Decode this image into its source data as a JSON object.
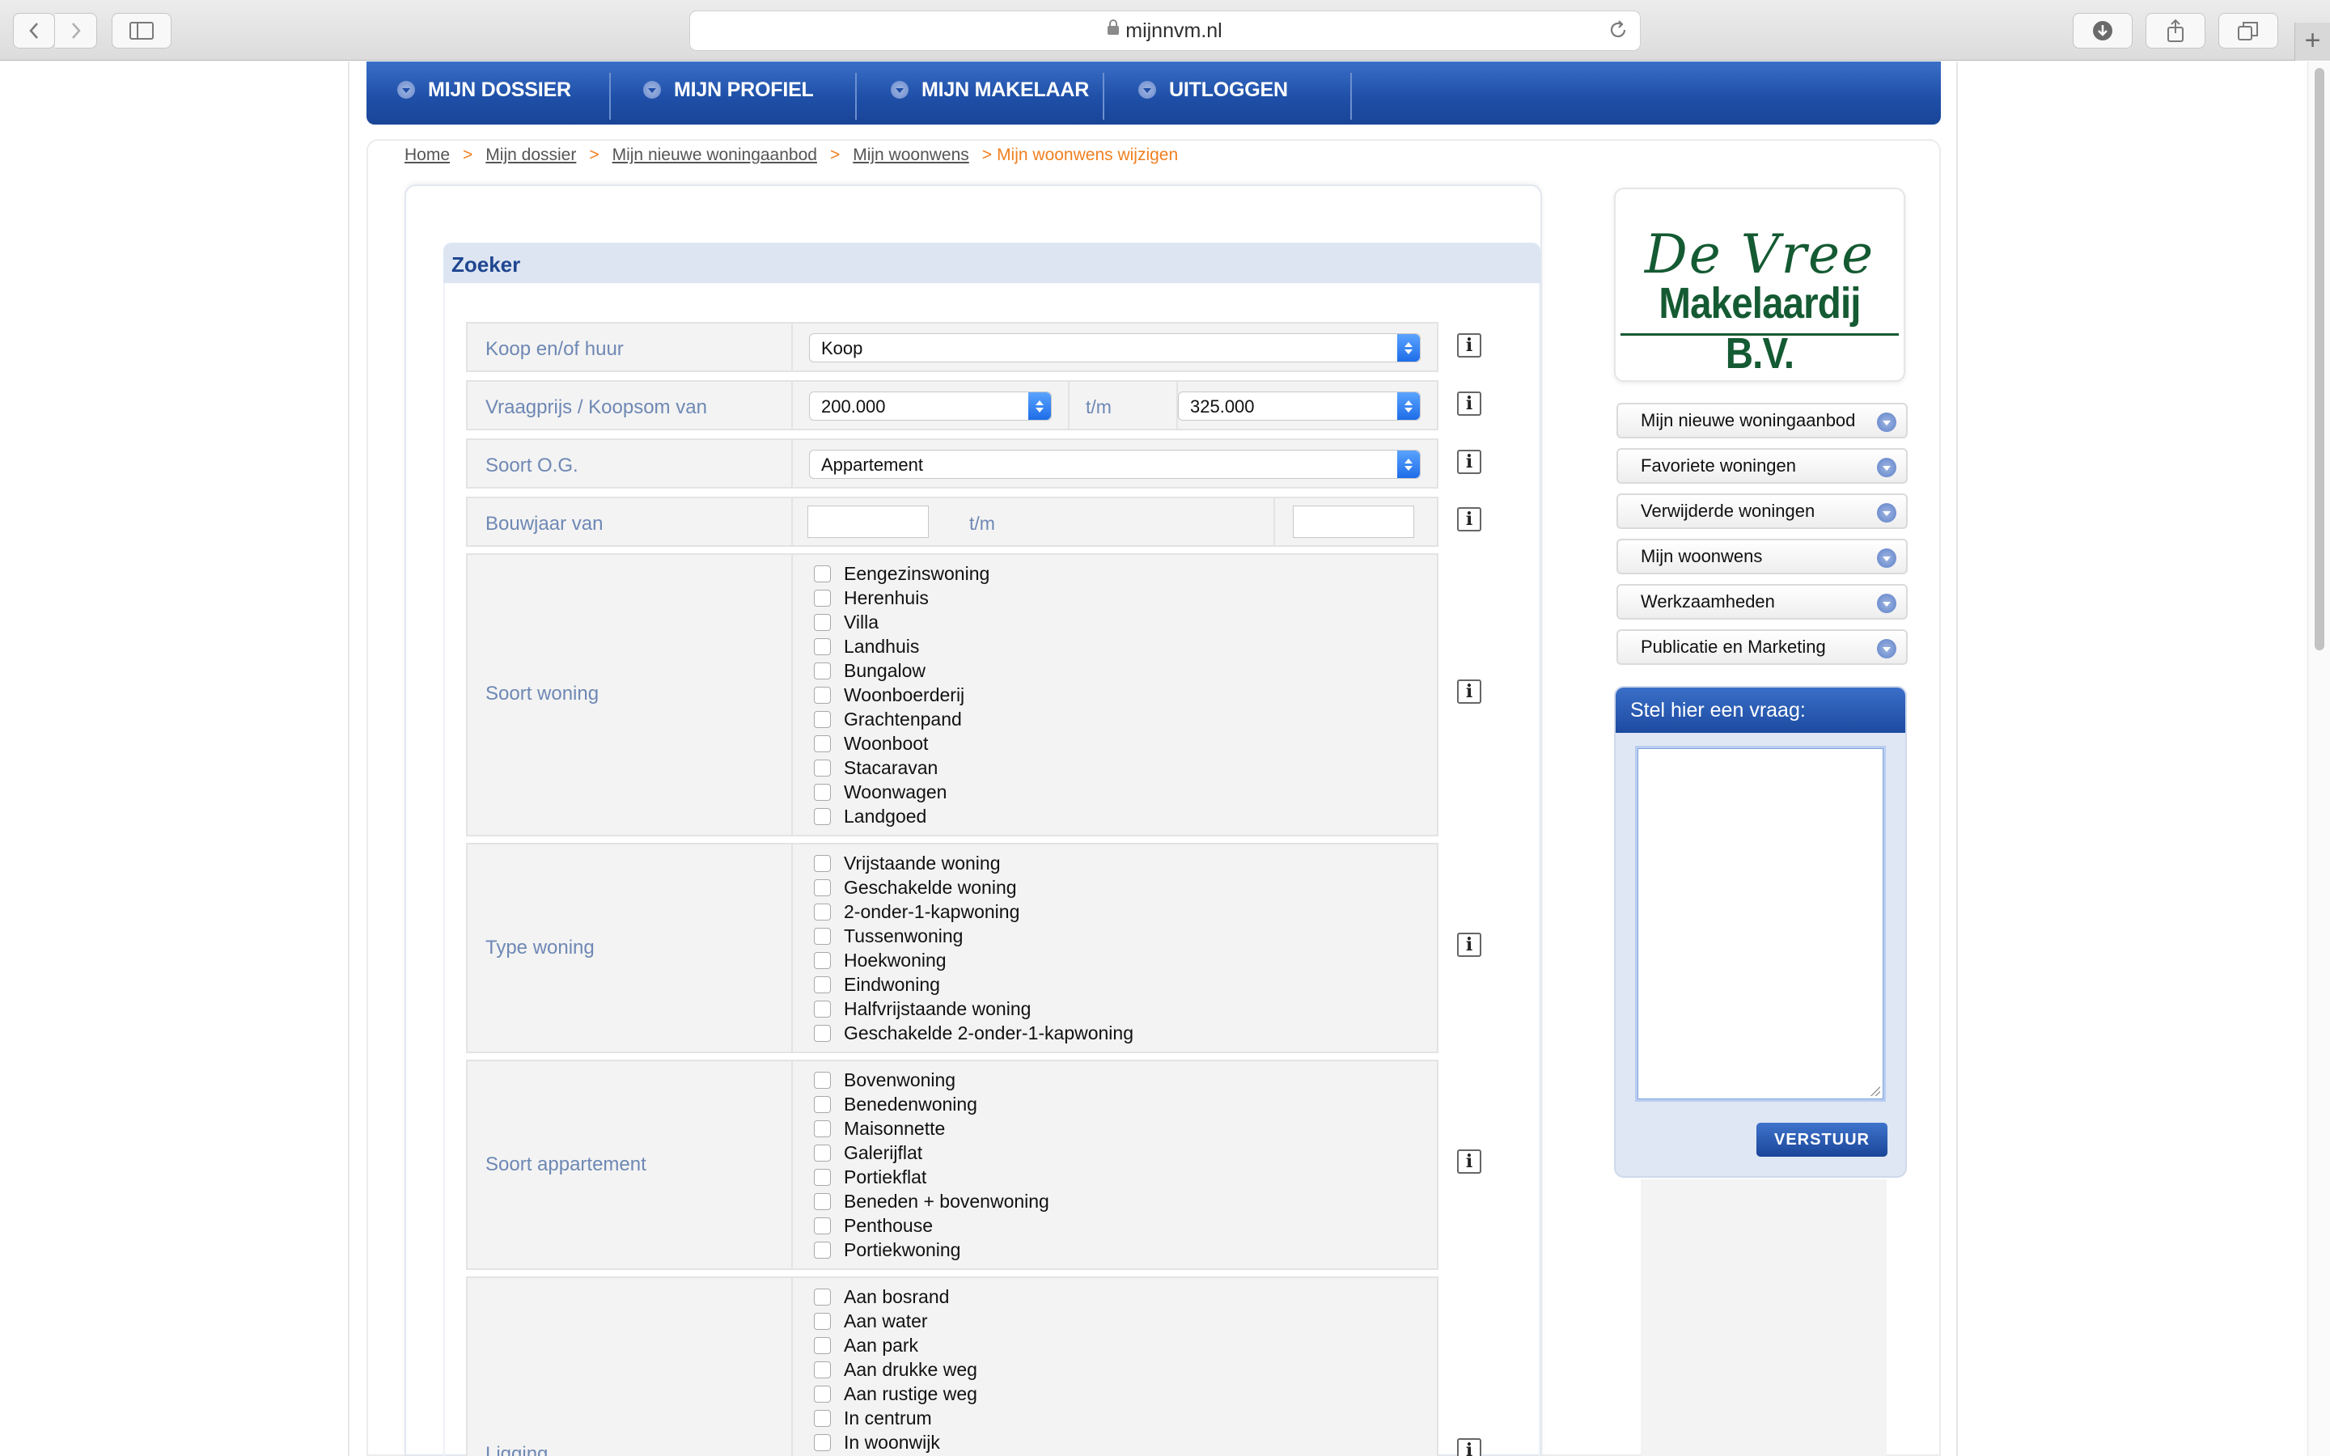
{
  "browser": {
    "url": "mijnnvm.nl"
  },
  "topnav": {
    "items": [
      {
        "label": "MIJN DOSSIER"
      },
      {
        "label": "MIJN PROFIEL"
      },
      {
        "label": "MIJN MAKELAAR"
      },
      {
        "label": "UITLOGGEN"
      }
    ]
  },
  "breadcrumb": {
    "items": [
      "Home",
      "Mijn dossier",
      "Mijn nieuwe woningaanbod",
      "Mijn woonwens"
    ],
    "current": "Mijn woonwens wijzigen",
    "separator": ">"
  },
  "section": {
    "title": "Zoeker"
  },
  "form": {
    "koop_huur": {
      "label": "Koop en/of huur",
      "value": "Koop"
    },
    "vraagprijs": {
      "label": "Vraagprijs / Koopsom van",
      "from": "200.000",
      "to_label": "t/m",
      "to": "325.000"
    },
    "soort_og": {
      "label": "Soort O.G.",
      "value": "Appartement"
    },
    "bouwjaar": {
      "label": "Bouwjaar van",
      "to_label": "t/m",
      "from": "",
      "to": ""
    },
    "soort_woning": {
      "label": "Soort woning",
      "options": [
        "Eengezinswoning",
        "Herenhuis",
        "Villa",
        "Landhuis",
        "Bungalow",
        "Woonboerderij",
        "Grachtenpand",
        "Woonboot",
        "Stacaravan",
        "Woonwagen",
        "Landgoed"
      ]
    },
    "type_woning": {
      "label": "Type woning",
      "options": [
        "Vrijstaande woning",
        "Geschakelde woning",
        "2-onder-1-kapwoning",
        "Tussenwoning",
        "Hoekwoning",
        "Eindwoning",
        "Halfvrijstaande woning",
        "Geschakelde 2-onder-1-kapwoning"
      ]
    },
    "soort_appartement": {
      "label": "Soort appartement",
      "options": [
        "Bovenwoning",
        "Benedenwoning",
        "Maisonnette",
        "Galerijflat",
        "Portiekflat",
        "Beneden + bovenwoning",
        "Penthouse",
        "Portiekwoning"
      ]
    },
    "ligging": {
      "label": "Ligging",
      "options": [
        "Aan bosrand",
        "Aan water",
        "Aan park",
        "Aan drukke weg",
        "Aan rustige weg",
        "In centrum",
        "In woonwijk"
      ]
    },
    "info_glyph": "i"
  },
  "sidebar": {
    "logo": {
      "line1": "De Vree",
      "line2": "Makelaardij B.V."
    },
    "buttons": [
      {
        "label": "Mijn nieuwe woningaanbod"
      },
      {
        "label": "Favoriete woningen"
      },
      {
        "label": "Verwijderde woningen"
      },
      {
        "label": "Mijn woonwens"
      },
      {
        "label": "Werkzaamheden"
      },
      {
        "label": "Publicatie en Marketing"
      }
    ],
    "question": {
      "title": "Stel hier een vraag:",
      "text": "",
      "submit": "VERSTUUR"
    }
  },
  "colors": {
    "nav_blue": "#1e4ea6",
    "label_blue": "#6e88b4",
    "breadcrumb_current": "#f08020",
    "logo_green": "#145a32"
  }
}
